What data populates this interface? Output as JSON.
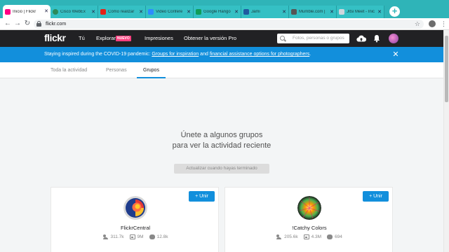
{
  "browser": {
    "tabs": [
      {
        "title": "Inicio | Flickr",
        "favicon_color": "#ff0084",
        "active": true
      },
      {
        "title": "Cisco WebEx ",
        "favicon_color": "#2b8a5a",
        "active": false
      },
      {
        "title": "Cómo realizar ",
        "favicon_color": "#e62117",
        "active": false
      },
      {
        "title": "Video Confere",
        "favicon_color": "#2d8cff",
        "active": false
      },
      {
        "title": "Google Hango",
        "favicon_color": "#0f9d58",
        "active": false
      },
      {
        "title": "Jami",
        "favicon_color": "#1e5aa0",
        "active": false
      },
      {
        "title": "Mumble.com |",
        "favicon_color": "#555555",
        "active": false
      },
      {
        "title": "Jitsi Meet - Inic",
        "favicon_color": "#cfd6dd",
        "active": false
      }
    ],
    "new_tab_label": "+",
    "url": "flickr.com",
    "star_glyph": "☆",
    "back_glyph": "←",
    "forward_glyph": "→",
    "reload_glyph": "↻",
    "menu_glyph": "⋮"
  },
  "header": {
    "logo": "flickr",
    "nav": {
      "you": "Tú",
      "explore": "Explorar",
      "explore_badge": "NUEVO",
      "prints": "Impresiones",
      "pro": "Obtener la versión Pro"
    },
    "search_placeholder": "Fotos, personas o grupos"
  },
  "banner": {
    "text_before": "Staying inspired during the COVID-19 pandemic: ",
    "link1": "Groups for inspiration",
    "text_middle": " and ",
    "link2": "financial assistance options for photographers",
    "text_after": ".",
    "close_glyph": "✕"
  },
  "subnav": {
    "tabs": [
      "Toda la actividad",
      "Personas",
      "Grupos"
    ],
    "active": "Grupos"
  },
  "empty_state": {
    "line1": "Únete a algunos grupos",
    "line2": "para ver la actividad reciente",
    "button": "Actualizar cuando hayas terminado"
  },
  "groups": [
    {
      "name": "FlickrCentral",
      "members": "311.7k",
      "photos": "9M",
      "discussions": "12.8k",
      "join_label": "+ Unir"
    },
    {
      "name": "!Catchy Colors",
      "members": "205.6k",
      "photos": "4.3M",
      "discussions": "694",
      "join_label": "+ Unir"
    }
  ],
  "colors": {
    "tabstrip": "#2fb4b8",
    "flickr_header": "#212124",
    "banner": "#128fdc",
    "accent": "#128fdc"
  }
}
